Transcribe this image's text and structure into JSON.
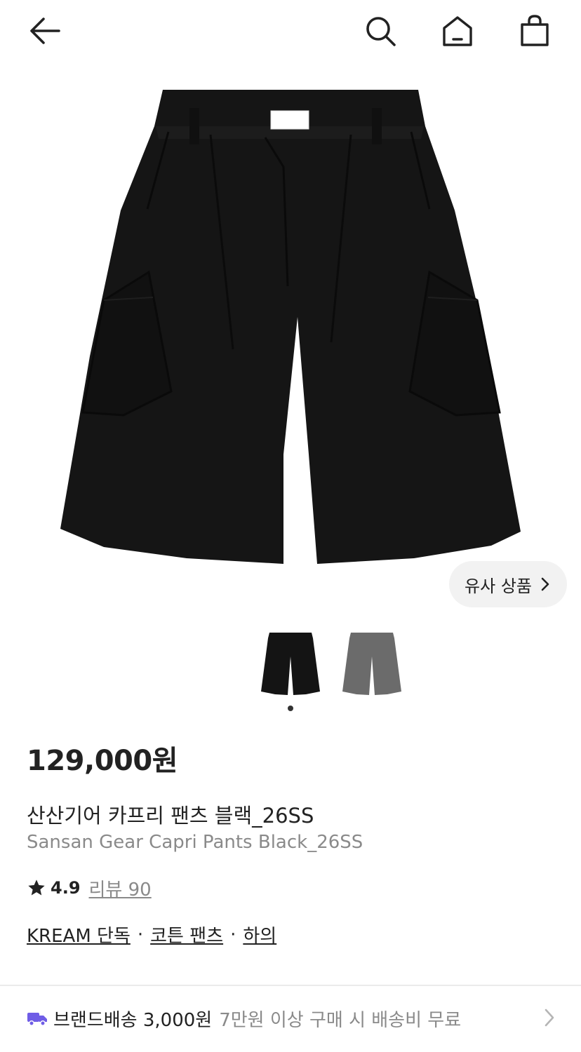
{
  "header": {
    "back_icon": "arrow-left-icon",
    "search_icon": "search-icon",
    "home_icon": "home-icon",
    "bag_icon": "shopping-bag-icon"
  },
  "similar_button": {
    "label": "유사 상품"
  },
  "thumbnails": [
    {
      "color": "#141414",
      "selected": true
    },
    {
      "color": "#6b6b6b",
      "selected": false
    }
  ],
  "product": {
    "price": "129,000원",
    "name_ko": "산산기어 카프리 팬츠 블랙_26SS",
    "name_en": "Sansan Gear Capri Pants Black_26SS",
    "rating": "4.9",
    "review_label": "리뷰 90",
    "tags": [
      "KREAM 단독",
      "코튼 팬츠",
      "하의"
    ],
    "tag_separator": "·"
  },
  "shipping": {
    "icon": "truck-icon",
    "title": "브랜드배송 3,000원",
    "note": "7만원 이상 구매 시 배송비 무료"
  },
  "colors": {
    "accent": "#6f5de6",
    "text": "#222222",
    "muted": "#8a8a8a",
    "pill_bg": "#f2f2f2"
  }
}
